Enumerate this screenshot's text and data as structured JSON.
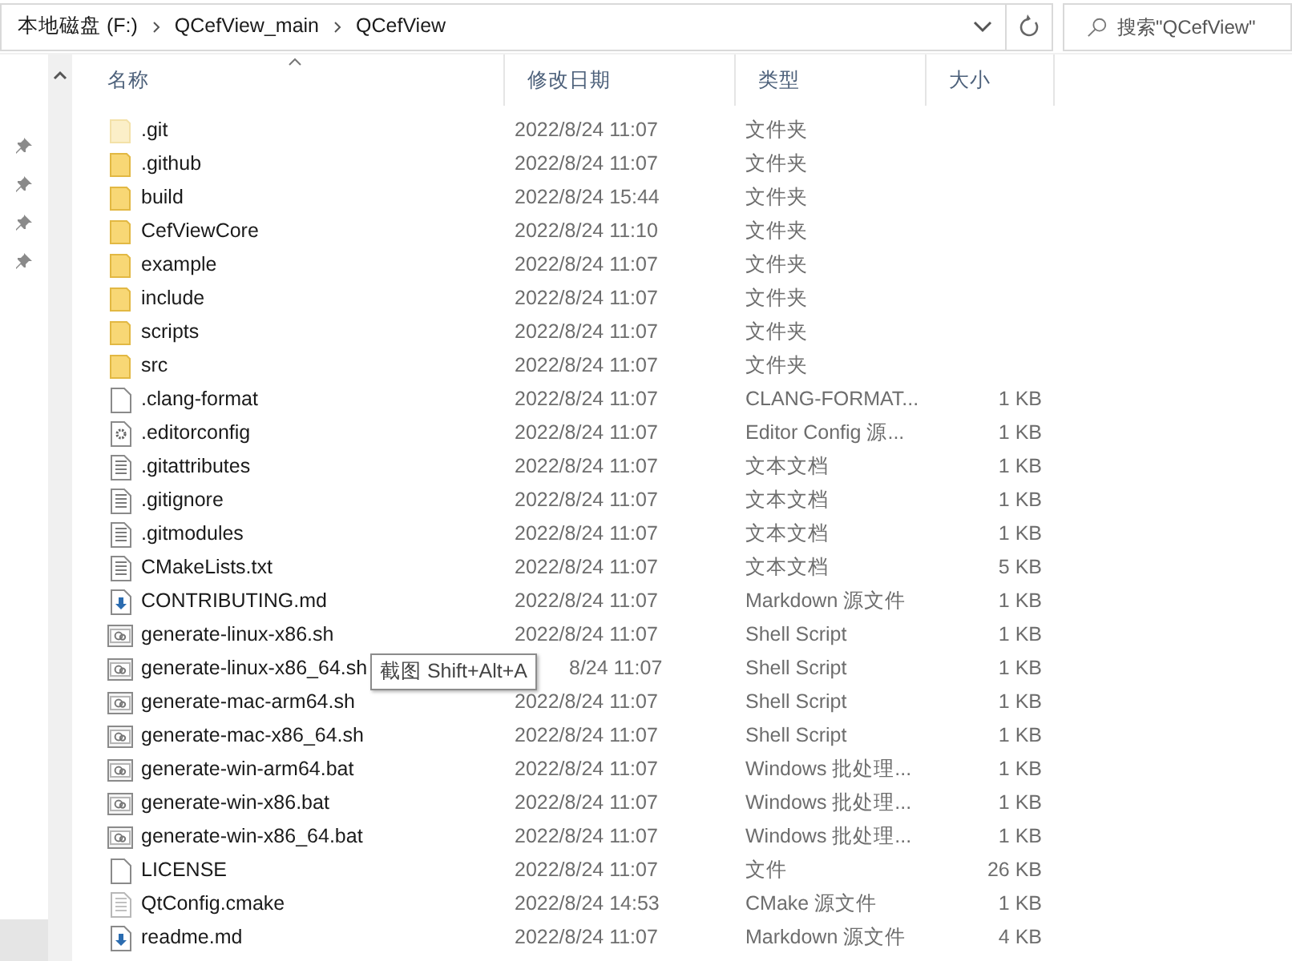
{
  "address_bar": {
    "breadcrumbs": [
      "本地磁盘 (F:)",
      "QCefView_main",
      "QCefView"
    ]
  },
  "search": {
    "placeholder": "搜索\"QCefView\""
  },
  "columns": [
    {
      "label": "名称",
      "sorted": true
    },
    {
      "label": "修改日期",
      "sorted": false
    },
    {
      "label": "类型",
      "sorted": false
    },
    {
      "label": "大小",
      "sorted": false
    }
  ],
  "files": [
    {
      "kind": "hidden-folder",
      "name": ".git",
      "modified": "2022/8/24 11:07",
      "type": "文件夹"
    },
    {
      "kind": "folder",
      "name": ".github",
      "modified": "2022/8/24 11:07",
      "type": "文件夹"
    },
    {
      "kind": "folder",
      "name": "build",
      "modified": "2022/8/24 15:44",
      "type": "文件夹"
    },
    {
      "kind": "folder",
      "name": "CefViewCore",
      "modified": "2022/8/24 11:10",
      "type": "文件夹"
    },
    {
      "kind": "folder",
      "name": "example",
      "modified": "2022/8/24 11:07",
      "type": "文件夹"
    },
    {
      "kind": "folder",
      "name": "include",
      "modified": "2022/8/24 11:07",
      "type": "文件夹"
    },
    {
      "kind": "folder",
      "name": "scripts",
      "modified": "2022/8/24 11:07",
      "type": "文件夹"
    },
    {
      "kind": "folder",
      "name": "src",
      "modified": "2022/8/24 11:07",
      "type": "文件夹"
    },
    {
      "kind": "file",
      "name": ".clang-format",
      "modified": "2022/8/24 11:07",
      "type": "CLANG-FORMAT...",
      "size": "1 KB"
    },
    {
      "kind": "config",
      "name": ".editorconfig",
      "modified": "2022/8/24 11:07",
      "type": "Editor Config 源...",
      "size": "1 KB"
    },
    {
      "kind": "text",
      "name": ".gitattributes",
      "modified": "2022/8/24 11:07",
      "type": "文本文档",
      "size": "1 KB"
    },
    {
      "kind": "text",
      "name": ".gitignore",
      "modified": "2022/8/24 11:07",
      "type": "文本文档",
      "size": "1 KB"
    },
    {
      "kind": "text",
      "name": ".gitmodules",
      "modified": "2022/8/24 11:07",
      "type": "文本文档",
      "size": "1 KB"
    },
    {
      "kind": "text",
      "name": "CMakeLists.txt",
      "modified": "2022/8/24 11:07",
      "type": "文本文档",
      "size": "5 KB"
    },
    {
      "kind": "markdown",
      "name": "CONTRIBUTING.md",
      "modified": "2022/8/24 11:07",
      "type": "Markdown 源文件",
      "size": "1 KB"
    },
    {
      "kind": "script",
      "name": "generate-linux-x86.sh",
      "modified": "2022/8/24 11:07",
      "type": "Shell Script",
      "size": "1 KB"
    },
    {
      "kind": "script",
      "name": "generate-linux-x86_64.sh",
      "modified": "8/24 11:07",
      "type": "Shell Script",
      "size": "1 KB",
      "tooltip": "截图 Shift+Alt+A"
    },
    {
      "kind": "script",
      "name": "generate-mac-arm64.sh",
      "modified": "2022/8/24 11:07",
      "type": "Shell Script",
      "size": "1 KB"
    },
    {
      "kind": "script",
      "name": "generate-mac-x86_64.sh",
      "modified": "2022/8/24 11:07",
      "type": "Shell Script",
      "size": "1 KB"
    },
    {
      "kind": "script",
      "name": "generate-win-arm64.bat",
      "modified": "2022/8/24 11:07",
      "type": "Windows 批处理...",
      "size": "1 KB"
    },
    {
      "kind": "script",
      "name": "generate-win-x86.bat",
      "modified": "2022/8/24 11:07",
      "type": "Windows 批处理...",
      "size": "1 KB"
    },
    {
      "kind": "script",
      "name": "generate-win-x86_64.bat",
      "modified": "2022/8/24 11:07",
      "type": "Windows 批处理...",
      "size": "1 KB"
    },
    {
      "kind": "file",
      "name": "LICENSE",
      "modified": "2022/8/24 11:07",
      "type": "文件",
      "size": "26 KB"
    },
    {
      "kind": "cmake",
      "name": "QtConfig.cmake",
      "modified": "2022/8/24 14:53",
      "type": "CMake 源文件",
      "size": "1 KB"
    },
    {
      "kind": "markdown",
      "name": "readme.md",
      "modified": "2022/8/24 11:07",
      "type": "Markdown 源文件",
      "size": "4 KB"
    }
  ]
}
